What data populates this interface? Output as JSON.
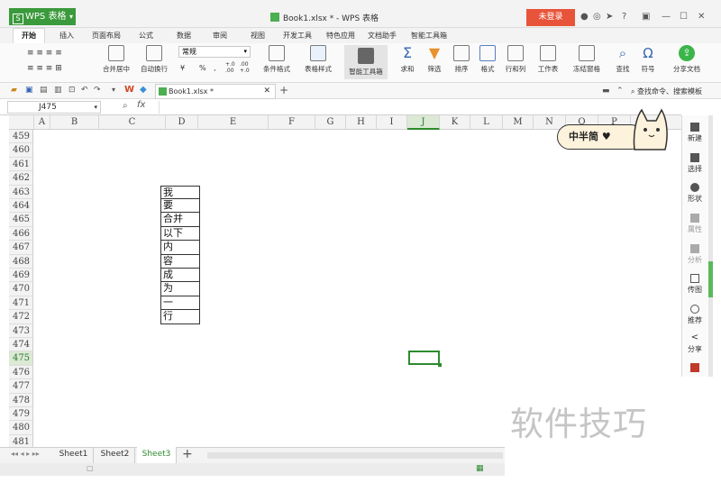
{
  "app": {
    "name": "WPS 表格",
    "logo": "S",
    "window_title": "Book1.xlsx * - WPS 表格",
    "login": "未登录",
    "accent": "#3b9a3b"
  },
  "menu_tabs": [
    "开始",
    "插入",
    "页面布局",
    "公式",
    "数据",
    "审阅",
    "视图",
    "开发工具",
    "特色应用",
    "文档助手",
    "智能工具箱"
  ],
  "ribbon": {
    "number_format": "常规",
    "percent": "%",
    "comma": ",",
    "inc_decimal": "+.0 .00",
    "dec_decimal": ".00 +.0",
    "items": [
      "合并居中",
      "自动换行",
      "条件格式",
      "表格样式",
      "智能工具箱",
      "求和",
      "筛选",
      "排序",
      "格式",
      "行和列",
      "工作表",
      "冻结窗格",
      "查找",
      "符号",
      "分享文档"
    ]
  },
  "quickbar": {
    "file_tab": "Book1.xlsx *",
    "search": "查找命令、搜索模板"
  },
  "formula": {
    "cell_ref": "J475",
    "fx": "fx",
    "value": ""
  },
  "columns": [
    "A",
    "B",
    "C",
    "D",
    "E",
    "F",
    "G",
    "H",
    "I",
    "J",
    "K",
    "L",
    "M",
    "N",
    "O",
    "P"
  ],
  "rows": [
    "459",
    "460",
    "461",
    "462",
    "463",
    "464",
    "465",
    "466",
    "467",
    "468",
    "469",
    "470",
    "471",
    "472",
    "473",
    "474",
    "475",
    "476",
    "477",
    "478",
    "479",
    "480",
    "481"
  ],
  "active_row": "475",
  "cells_D": [
    "我",
    "要",
    "合并",
    "以下",
    "内",
    "容",
    "成",
    "为",
    "一",
    "行"
  ],
  "sidebar": [
    "新建",
    "选择",
    "形状",
    "属性",
    "分析",
    "传图",
    "推荐",
    "分享"
  ],
  "sticker": "中半简 ♥",
  "sheets": [
    "Sheet1",
    "Sheet2",
    "Sheet3"
  ],
  "active_sheet": "Sheet3",
  "watermark": "软件技巧"
}
